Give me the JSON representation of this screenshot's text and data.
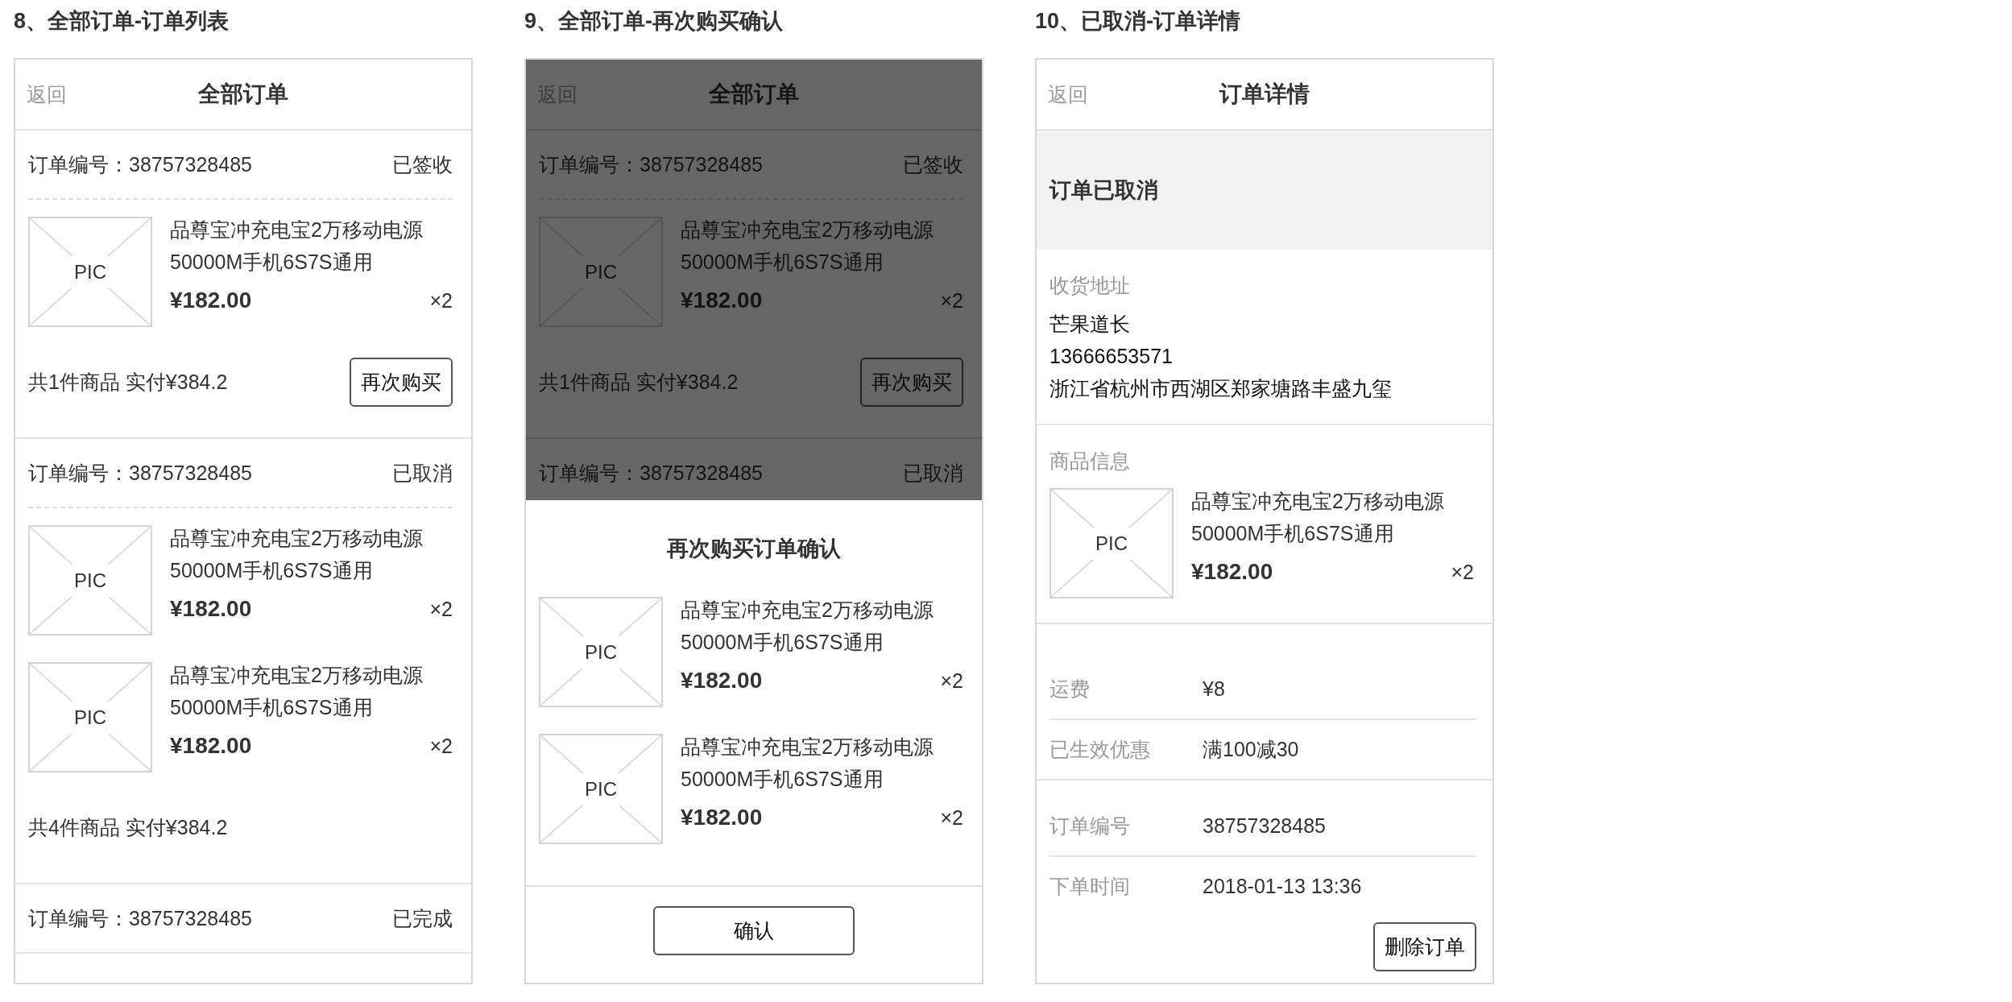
{
  "screens": [
    {
      "kind": "order_list",
      "caption": "8、全部订单-订单列表",
      "back": "返回",
      "title": "全部订单",
      "orders": [
        {
          "number": "订单编号：38757328485",
          "status": "已签收",
          "items": [
            {
              "image_label": "PIC",
              "name": "品尊宝冲充电宝2万移动电源50000M手机6S7S通用",
              "price": "¥182.00",
              "qty": "×2"
            }
          ],
          "summary": "共1件商品 实付¥384.2",
          "button": "再次购买"
        },
        {
          "number": "订单编号：38757328485",
          "status": "已取消",
          "items": [
            {
              "image_label": "PIC",
              "name": "品尊宝冲充电宝2万移动电源50000M手机6S7S通用",
              "price": "¥182.00",
              "qty": "×2"
            },
            {
              "image_label": "PIC",
              "name": "品尊宝冲充电宝2万移动电源50000M手机6S7S通用",
              "price": "¥182.00",
              "qty": "×2"
            }
          ],
          "summary": "共4件商品 实付¥384.2"
        },
        {
          "number": "订单编号：38757328485",
          "status": "已完成"
        }
      ]
    },
    {
      "kind": "reorder_confirm",
      "caption": "9、全部订单-再次购买确认",
      "back": "返回",
      "title": "全部订单",
      "overlay": true,
      "orders": [
        {
          "number": "订单编号：38757328485",
          "status": "已签收",
          "items": [
            {
              "image_label": "PIC",
              "name": "品尊宝冲充电宝2万移动电源50000M手机6S7S通用",
              "price": "¥182.00",
              "qty": "×2"
            }
          ],
          "summary": "共1件商品 实付¥384.2",
          "button": "再次购买"
        },
        {
          "number": "订单编号：38757328485",
          "status": "已取消"
        }
      ],
      "dialog": {
        "title": "再次购买订单确认",
        "items": [
          {
            "image_label": "PIC",
            "name": "品尊宝冲充电宝2万移动电源50000M手机6S7S通用",
            "price": "¥182.00",
            "qty": "×2"
          },
          {
            "image_label": "PIC",
            "name": "品尊宝冲充电宝2万移动电源50000M手机6S7S通用",
            "price": "¥182.00",
            "qty": "×2"
          }
        ],
        "button": "确认"
      }
    },
    {
      "kind": "order_detail",
      "caption": "10、已取消-订单详情",
      "back": "返回",
      "title": "订单详情",
      "status_banner": "订单已取消",
      "address": {
        "label": "收货地址",
        "lines": [
          "芒果道长",
          "13666653571",
          "浙江省杭州市西湖区郑家塘路丰盛九玺"
        ]
      },
      "goods": {
        "label": "商品信息",
        "items": [
          {
            "image_label": "PIC",
            "name": "品尊宝冲充电宝2万移动电源50000M手机6S7S通用",
            "price": "¥182.00",
            "qty": "×2"
          }
        ]
      },
      "fees": [
        {
          "label": "运费",
          "value": "¥8"
        },
        {
          "label": "已生效优惠",
          "value": "满100减30"
        }
      ],
      "info": [
        {
          "label": "订单编号",
          "value": "38757328485"
        },
        {
          "label": "下单时间",
          "value": "2018-01-13 13:36"
        }
      ],
      "button": "删除订单"
    }
  ]
}
